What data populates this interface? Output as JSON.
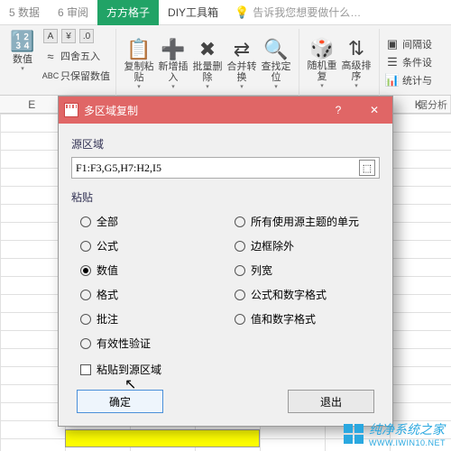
{
  "tabs": {
    "t0": "5 数据",
    "t1": "6 审阅",
    "active": "方方格子",
    "t3": "DIY工具箱",
    "tell_me": "告诉我您想要做什么…"
  },
  "ribbon": {
    "left": {
      "round": "四舍五入",
      "keepnum": "只保留数值",
      "group": "数值"
    },
    "copy": {
      "label": "复制粘贴",
      "insert": "新增插入",
      "delete": "批量删除",
      "merge": "合并转换",
      "find": "查找定位"
    },
    "right": {
      "rand": "随机重复",
      "sort": "高级排序",
      "gap": "间隔设",
      "cond": "条件设",
      "stat": "统计与",
      "analysis": "据分析"
    }
  },
  "columns": {
    "E": "E",
    "K": "K"
  },
  "dialog": {
    "title": "多区域复制",
    "src_label": "源区域",
    "src_value": "F1:F3,G5,H7:H2,I5",
    "paste_label": "粘贴",
    "radios": {
      "all": "全部",
      "topic": "所有使用源主题的单元",
      "formula": "公式",
      "border": "边框除外",
      "value": "数值",
      "colw": "列宽",
      "format": "格式",
      "fnum": "公式和数字格式",
      "comment": "批注",
      "vnum": "值和数字格式",
      "valid": "有效性验证"
    },
    "chk": "粘贴到源区域",
    "ok": "确定",
    "cancel": "退出"
  },
  "watermark": {
    "text": "纯净系统之家",
    "url": "WWW.IWIN10.NET"
  }
}
